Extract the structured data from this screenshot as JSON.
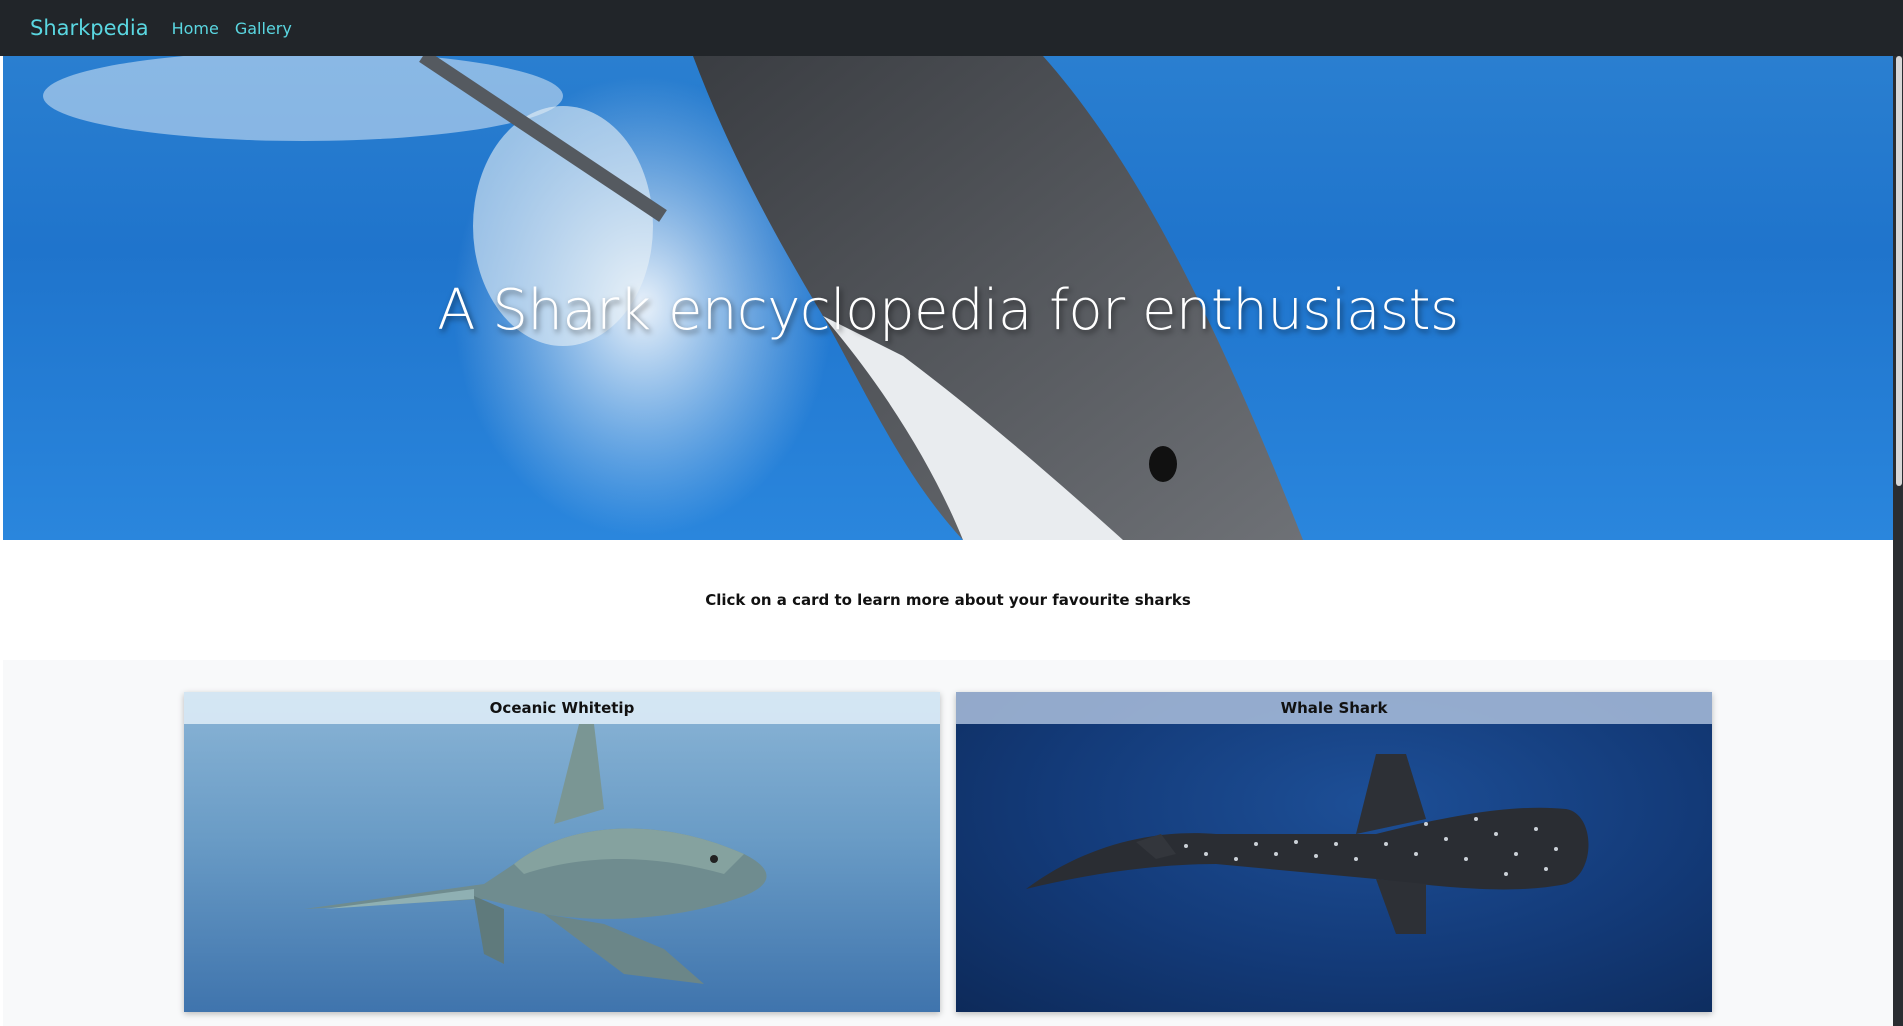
{
  "nav": {
    "brand": "Sharkpedia",
    "links": [
      "Home",
      "Gallery"
    ],
    "accent_color": "#5ad7e1"
  },
  "hero": {
    "title": "A Shark encyclopedia for enthusiasts"
  },
  "intro": {
    "text": "Click on a card to learn more about your favourite sharks"
  },
  "cards": [
    {
      "title": "Oceanic Whitetip",
      "image": "oceanic-whitetip-photo"
    },
    {
      "title": "Whale Shark",
      "image": "whale-shark-photo"
    }
  ]
}
